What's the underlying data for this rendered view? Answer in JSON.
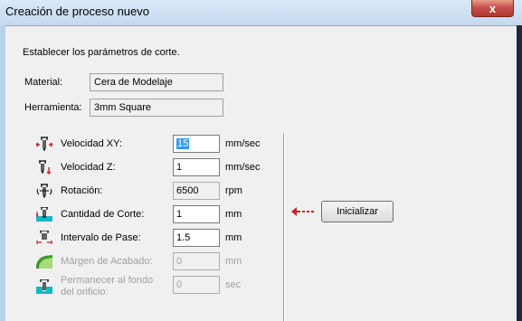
{
  "window": {
    "title": "Creación de proceso nuevo",
    "close_glyph": "x"
  },
  "instructions": "Establecer los parámetros de corte.",
  "material": {
    "label": "Material:",
    "value": "Cera de Modelaje"
  },
  "tool": {
    "label": "Herramienta:",
    "value": "3mm Square"
  },
  "params": {
    "xy_speed": {
      "label": "Velocidad XY:",
      "value": "15",
      "unit": "mm/sec",
      "icon": "xy-speed-icon"
    },
    "z_speed": {
      "label": "Velocidad Z:",
      "value": "1",
      "unit": "mm/sec",
      "icon": "z-speed-icon"
    },
    "rotation": {
      "label": "Rotación:",
      "value": "6500",
      "unit": "rpm",
      "icon": "spindle-rotation-icon"
    },
    "cut_amount": {
      "label": "Cantidad de Corte:",
      "value": "1",
      "unit": "mm",
      "icon": "cut-depth-icon"
    },
    "step_over": {
      "label": "Intervalo de Pase:",
      "value": "1.5",
      "unit": "mm",
      "icon": "step-over-icon"
    },
    "finish_margin": {
      "label": "Márgen de Acabado:",
      "value": "0",
      "unit": "mm",
      "icon": "finish-margin-icon"
    },
    "hole_bottom_line1": "Permanecer al fondo",
    "hole_bottom_line2": "del orificio:",
    "hole_bottom": {
      "value": "0",
      "unit": "sec",
      "icon": "dwell-icon"
    }
  },
  "init_button": {
    "label": "Inicializar",
    "icon": "arrow-left-icon"
  },
  "colors": {
    "icon_red": "#c8202a",
    "icon_teal": "#1ab6c6",
    "icon_green": "#3a9a2a",
    "selection": "#3399ff"
  }
}
